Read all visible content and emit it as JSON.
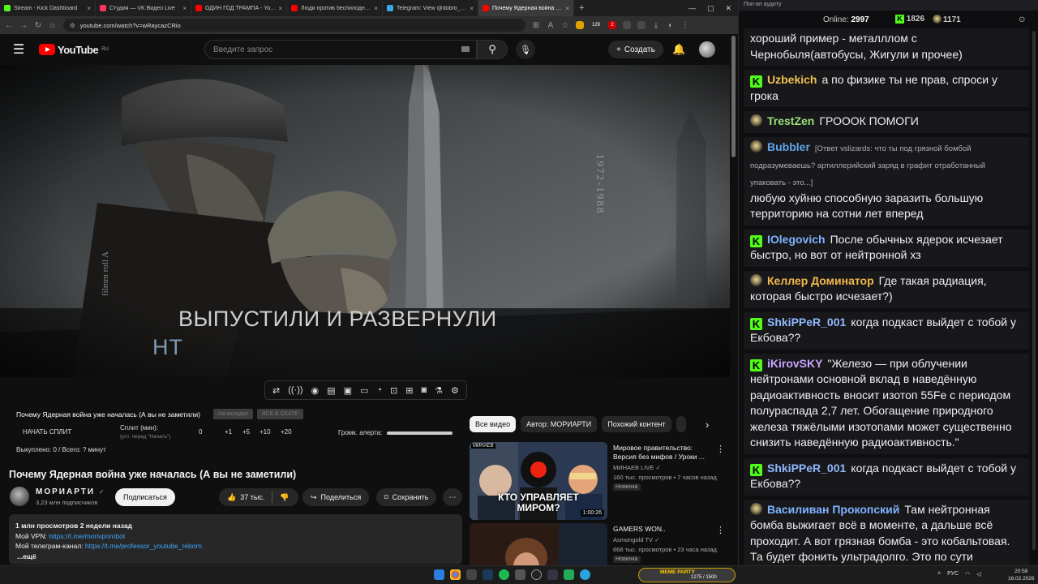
{
  "browser": {
    "tabs": [
      {
        "label": "Stream - Kick Dashboard",
        "color": "#53fc18"
      },
      {
        "label": "Студия — VK Видео Live",
        "color": "#ff3366"
      },
      {
        "label": "ОДИН ГОД ТРАМПА - YouTube",
        "color": "#ff0000"
      },
      {
        "label": "Люди против беспилоднй: сен",
        "color": "#ff0000"
      },
      {
        "label": "Telegram: View @dobro_2ch",
        "color": "#3aa5e8"
      },
      {
        "label": "Почему Ядерная война уже н",
        "color": "#ff0000"
      }
    ],
    "url": "youtube.com/watch?v=wRaycazCRio",
    "ext_badges": [
      "129",
      "2"
    ]
  },
  "youtube": {
    "logo": "YouTube",
    "region": "RU",
    "search_placeholder": "Введите запрос",
    "create_label": "Создать"
  },
  "player": {
    "subtitle_line1": "ВЫПУСТИЛИ И РАЗВЕРНУЛИ",
    "subtitle_line2": "НТ",
    "film_roll": "filmm roll A",
    "years": "1972-1988"
  },
  "split_panel": {
    "title": "Почему Ядерная война уже началась (А вы не заметили)",
    "chip1": "На вкладке",
    "chip2": "ВСЕ В СКАТЕ",
    "split_btn": "НАЧАТЬ СПЛИТ",
    "split_min": "Сплит (мин):",
    "split_hint": "(уст. перед \"Начать\")",
    "values": [
      "0",
      "+1",
      "+5",
      "+10",
      "+20"
    ],
    "volume_label": "Громк. алерта:",
    "status": "Выкуплено: 0 / Всего: ? минут"
  },
  "video": {
    "title": "Почему Ядерная война уже началась (А вы не заметили)",
    "channel": "МОРИАРТИ",
    "subscribers": "3,23 млн подписчиков",
    "subscribe": "Подписаться",
    "likes": "37 тыс.",
    "share": "Поделиться",
    "save": "Сохранить",
    "desc_stats": "1 млн просмотров  2 недели назад",
    "desc_vpn_label": "Мой VPN: ",
    "desc_vpn_link": "https://t.me/morivpnrobot",
    "desc_tg_label": "Мой телеграм-канал: ",
    "desc_tg_link": "https://t.me/professor_youtube_reborn",
    "desc_more": "...ещё"
  },
  "recommend": {
    "chips": [
      "Все видео",
      "Автор: МОРИАРТИ",
      "Похожий контент"
    ],
    "items": [
      {
        "title": "Мировое правительство: Версия без мифов / Уроки ...",
        "channel": "МИНАЕВ LIVE",
        "meta": "160 тыс. просмотров • 7 часов назад",
        "badge": "Новинка",
        "duration": "1:00:26",
        "thumb_text1": "КТО УПРАВЛЯЕТ",
        "thumb_text2": "МИРОМ?",
        "thumb_tag": "МИНАЕВ"
      },
      {
        "title": "GAMERS WON..",
        "channel": "Asmongold TV",
        "meta": "668 тыс. просмотров • 23 часа назад",
        "badge": "Новинка"
      }
    ]
  },
  "chat": {
    "header": "Поп-ап аудиту",
    "online_label": "Online:",
    "online": "2997",
    "kick_count": "1826",
    "vk_count": "1171",
    "messages": [
      {
        "user": "",
        "badge": "",
        "color": "#efeff1",
        "text": "хороший пример - металллом с Чернобыля(автобусы, Жигули и прочее)"
      },
      {
        "user": "Uzbekich",
        "badge": "kick",
        "color": "#f2c14e",
        "text": "а по физике ты не прав, спроси у грока"
      },
      {
        "user": "TrestZen",
        "badge": "vk",
        "color": "#9adf7a",
        "text": "ГРОООК ПОМОГИ"
      },
      {
        "user": "Bubbler",
        "badge": "vk",
        "color": "#5fa6e8",
        "reply": "[Ответ vslizards: что ты под грязной бомбой подразумеваешь? артиллерийский заряд в графит отработанный упаковать - это...]",
        "text": "любую хуйню способную заразить большую территорию на сотни лет вперед"
      },
      {
        "user": "IOlegovich",
        "badge": "kick",
        "color": "#7fb2ff",
        "text": "После обычных ядерок исчезает быстро, но вот от нейтронной хз"
      },
      {
        "user": "Келлер Доминатор",
        "badge": "vk",
        "color": "#f2b84b",
        "text": "Где такая радиация, которая быстро исчезает?)"
      },
      {
        "user": "ShkiPPeR_001",
        "badge": "kick",
        "color": "#8fb8ff",
        "text": "когда подкаст выйдет с тобой у Екбова??"
      },
      {
        "user": "iKirovSKY",
        "badge": "kick",
        "color": "#c8a4ff",
        "text": "\"Железо — при облучении нейтронами основной вклад в наведённую радиоактивность вносит изотоп 55Fe с периодом полураспада 2,7 лет. Обогащение природного железа тяжёлыми изотопами может существенно снизить наведённую радиоактивность.\""
      },
      {
        "user": "ShkiPPeR_001",
        "badge": "kick",
        "color": "#8fb8ff",
        "text": "когда подкаст выйдет с тобой у Екбова??"
      },
      {
        "user": "Василиван Прокопский",
        "badge": "vk",
        "color": "#7fb2ff",
        "text": "Там нейтронная бомба выжигает всё в моменте, а дальше всё проходит. А вот грязная бомба - это кобальтовая. Та будет фонить ультрадолго. Это по сути зачистка."
      }
    ]
  },
  "taskbar": {
    "meme_title": "MEME PARTY",
    "meme_count": "1275 / 1500",
    "lang": "РУС",
    "time": "20:58",
    "date": "16.02.2026"
  }
}
